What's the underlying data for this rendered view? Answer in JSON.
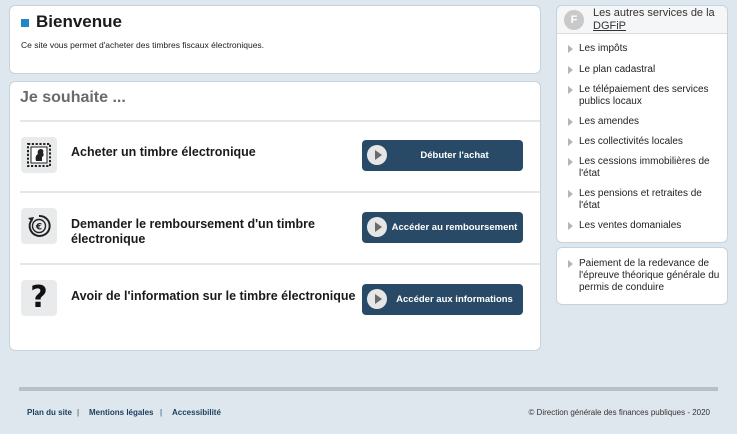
{
  "welcome": {
    "title": "Bienvenue",
    "description": "Ce site vous permet d'acheter des timbres fiscaux électroniques."
  },
  "wish": {
    "title": "Je souhaite ...",
    "rows": [
      {
        "label": "Acheter un timbre électronique",
        "button": "Débuter l'achat",
        "icon": "stamp-icon"
      },
      {
        "label": "Demander le remboursement d'un timbre électronique",
        "button": "Accéder au remboursement",
        "icon": "euro-refund-icon"
      },
      {
        "label": "Avoir de l'information sur le timbre électronique",
        "button": "Accéder aux informations",
        "icon": "question-mark-icon"
      }
    ]
  },
  "services": {
    "heading_line1": "Les autres services de la",
    "heading_line2": "DGFiP",
    "logo_glyph": "F",
    "items": [
      "Les impôts",
      "Le plan cadastral",
      "Le télépaiement des services publics locaux",
      "Les amendes",
      "Les collectivités locales",
      "Les cessions immobilières de l'état",
      "Les pensions et retraites de l'état",
      "Les ventes domaniales"
    ]
  },
  "redevance": {
    "link": "Paiement de la redevance de l'épreuve théorique générale du permis de conduire"
  },
  "footer": {
    "links": [
      "Plan du site",
      "Mentions légales",
      "Accessibilité"
    ],
    "separator": "|",
    "copyright": "© Direction générale des finances publiques - 2020"
  },
  "colors": {
    "button_bg": "#294a67",
    "accent": "#1f87c7",
    "page_bg": "#dfe7ee"
  }
}
